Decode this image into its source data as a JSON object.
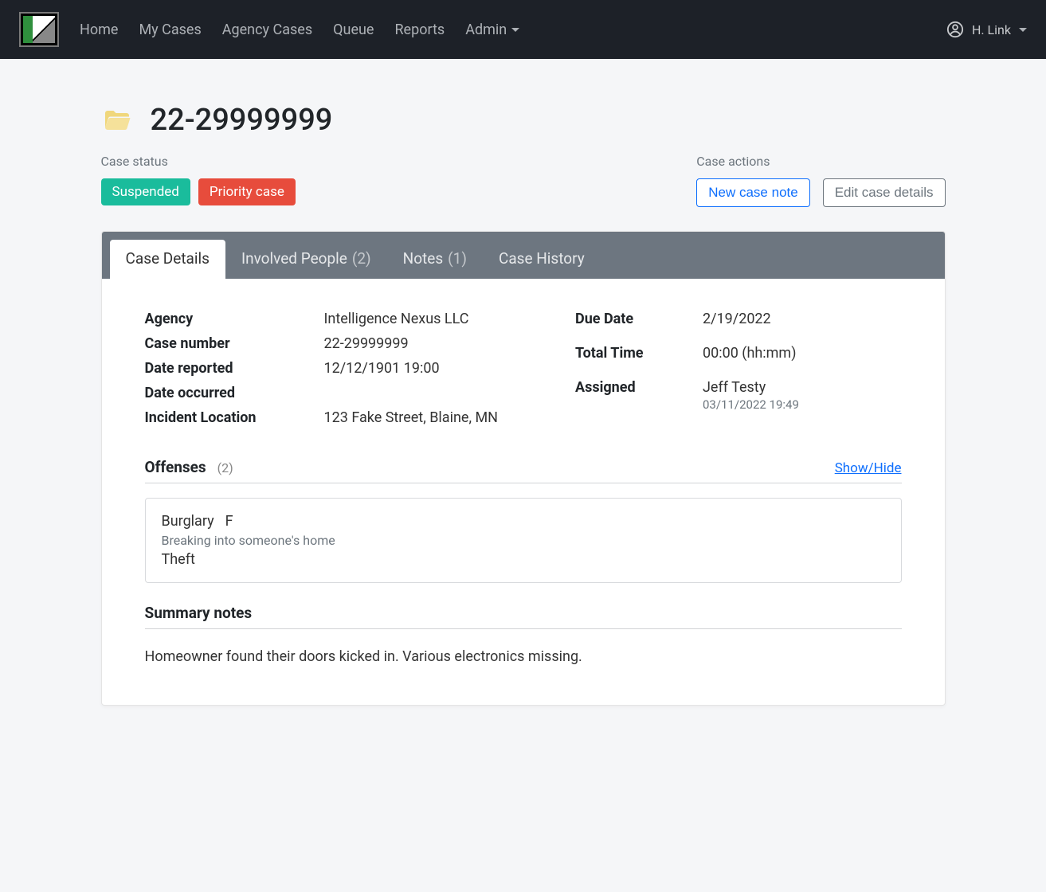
{
  "nav": {
    "links": [
      "Home",
      "My Cases",
      "Agency Cases",
      "Queue",
      "Reports",
      "Admin"
    ],
    "user_name": "H. Link"
  },
  "case": {
    "number": "22-29999999",
    "status_label": "Case status",
    "badges": {
      "suspended": "Suspended",
      "priority": "Priority case"
    },
    "actions_label": "Case actions",
    "actions": {
      "new_note": "New case note",
      "edit": "Edit case details"
    }
  },
  "tabs": {
    "case_details": "Case Details",
    "involved_people": "Involved People",
    "involved_people_count": "(2)",
    "notes": "Notes",
    "notes_count": "(1)",
    "case_history": "Case History"
  },
  "details": {
    "agency_label": "Agency",
    "agency_value": "Intelligence Nexus LLC",
    "case_number_label": "Case number",
    "case_number_value": "22-29999999",
    "date_reported_label": "Date reported",
    "date_reported_value": "12/12/1901 19:00",
    "date_occurred_label": "Date occurred",
    "date_occurred_value": "",
    "incident_location_label": "Incident Location",
    "incident_location_value": "123 Fake Street, Blaine, MN",
    "due_date_label": "Due Date",
    "due_date_value": "2/19/2022",
    "total_time_label": "Total Time",
    "total_time_value": "00:00 (hh:mm)",
    "assigned_label": "Assigned",
    "assigned_value": "Jeff Testy",
    "assigned_timestamp": "03/11/2022 19:49"
  },
  "offenses": {
    "header": "Offenses",
    "count": "(2)",
    "toggle": "Show/Hide",
    "items": [
      {
        "title": "Burglary",
        "class": "F",
        "description": "Breaking into someone's home",
        "sub": "Theft"
      }
    ]
  },
  "summary": {
    "header": "Summary notes",
    "text": "Homeowner found their doors kicked in. Various electronics missing."
  }
}
